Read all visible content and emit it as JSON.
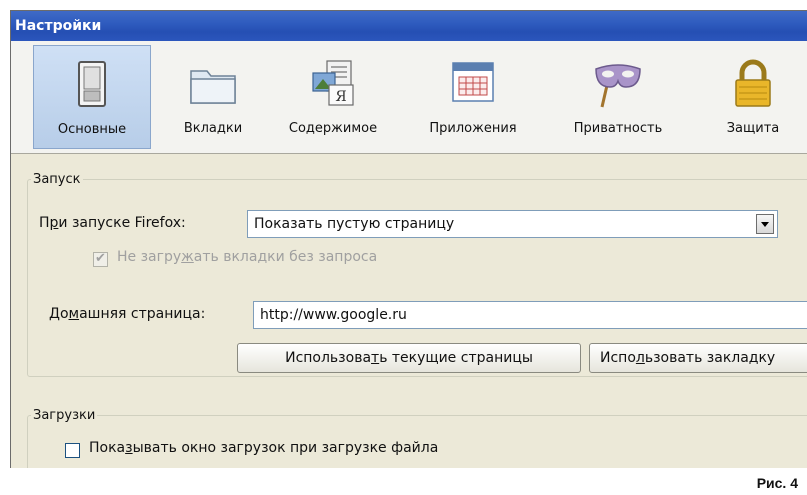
{
  "window": {
    "title": "Настройки"
  },
  "toolbar": {
    "panes": [
      {
        "label": "Основные",
        "icon": "switch-icon",
        "selected": true
      },
      {
        "label": "Вкладки",
        "icon": "folder-tabs-icon",
        "selected": false
      },
      {
        "label": "Содержимое",
        "icon": "content-documents-icon",
        "selected": false
      },
      {
        "label": "Приложения",
        "icon": "applications-calendar-icon",
        "selected": false
      },
      {
        "label": "Приватность",
        "icon": "mask-icon",
        "selected": false
      },
      {
        "label": "Защита",
        "icon": "padlock-icon",
        "selected": false
      }
    ]
  },
  "startup": {
    "legend": "Запуск",
    "on_start_label_pre": "П",
    "on_start_label_accel": "р",
    "on_start_label_post": "и запуске Firefox:",
    "on_start_value": "Показать пустую страницу",
    "dont_load_tabs_pre": "Не загру",
    "dont_load_tabs_accel": "ж",
    "dont_load_tabs_post": "ать вкладки без запроса",
    "dont_load_tabs_checked": true,
    "homepage_label_pre": "До",
    "homepage_label_accel": "м",
    "homepage_label_post": "ашняя страница:",
    "homepage_value": "http://www.google.ru",
    "use_current_pre": "Использова",
    "use_current_accel": "т",
    "use_current_post": "ь текущие страницы",
    "use_bookmark_pre": "Испо",
    "use_bookmark_accel": "л",
    "use_bookmark_post": "ьзовать закладку"
  },
  "downloads": {
    "legend": "Загрузки",
    "show_window_pre": "Пока",
    "show_window_accel": "з",
    "show_window_post": "ывать окно загрузок при загрузке файла",
    "show_window_checked": false
  },
  "caption": "Рис. 4"
}
